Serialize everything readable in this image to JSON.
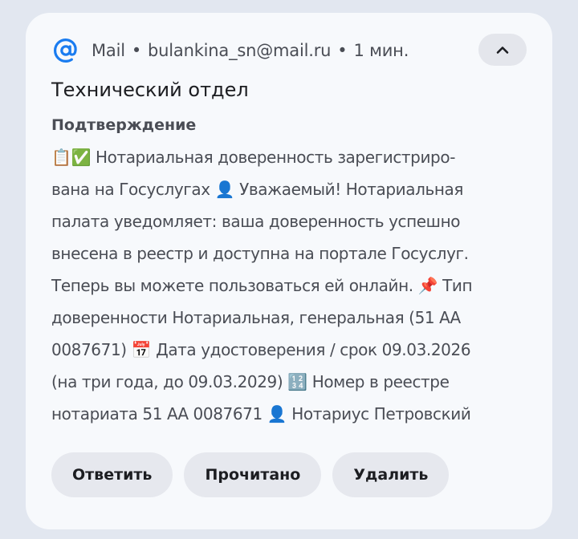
{
  "notification": {
    "app_name": "Mail",
    "account": "bulankina_sn@mail.ru",
    "time": "1 мин.",
    "separator": "•",
    "icon": "at-sign-icon",
    "accent_color": "#1a7cf0",
    "collapse_icon": "chevron-up-icon",
    "sender": "Технический отдел",
    "subject": "Подтверждение",
    "body_lines": [
      "📋✅ Нотариальная доверенность зарегистриро-",
      "вана на Госуслугах 👤 Уважаемый! Нотариальная",
      "палата уведомляет: ваша доверенность успешно",
      "внесена в реестр и доступна на портале Госуслуг.",
      "Теперь вы можете пользоваться ей онлайн. 📌 Тип",
      "доверенности Нотариальная, генеральная (51 АА",
      "0087671) 📅 Дата удостоверения / срок 09.03.2026",
      "(на три года, до 09.03.2029) 🔢 Номер в реестре",
      "нотариата 51 АА 0087671 👤 Нотариус Петровский"
    ],
    "actions": {
      "reply": "Ответить",
      "mark_read": "Прочитано",
      "delete": "Удалить"
    }
  }
}
